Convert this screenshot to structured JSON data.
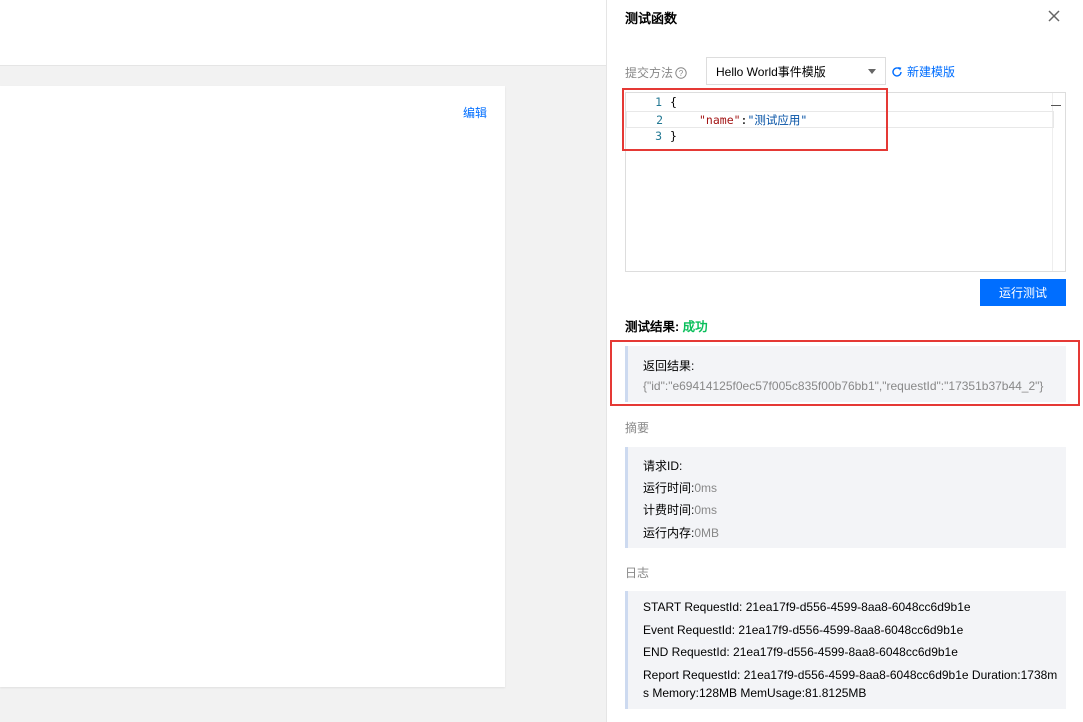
{
  "background": {
    "edit_label": "编辑"
  },
  "panel": {
    "title": "测试函数",
    "submit_method_label": "提交方法",
    "template_select_value": "Hello World事件模版",
    "new_template_label": "新建模版",
    "editor_lines": [
      {
        "no": "1",
        "code": "{"
      },
      {
        "no": "2",
        "key": "\"name\"",
        "sep": ":",
        "val": "\"测试应用\""
      },
      {
        "no": "3",
        "code": "}"
      }
    ],
    "run_button_label": "运行测试",
    "result_title": "测试结果:",
    "result_status": "成功",
    "return_label": "返回结果:",
    "return_value": "{\"id\":\"e69414125f0ec57f005c835f00b76bb1\",\"requestId\":\"17351b37b44_2\"}",
    "summary_label": "摘要",
    "summary": {
      "request_id_label": "请求ID:",
      "request_id_value": "",
      "run_time_label": "运行时间:",
      "run_time_value": "0ms",
      "billing_time_label": "计费时间:",
      "billing_time_value": "0ms",
      "memory_label": "运行内存:",
      "memory_value": "0MB"
    },
    "log_label": "日志",
    "log_lines": [
      "START RequestId: 21ea17f9-d556-4599-8aa8-6048cc6d9b1e",
      "Event RequestId: 21ea17f9-d556-4599-8aa8-6048cc6d9b1e",
      "END RequestId: 21ea17f9-d556-4599-8aa8-6048cc6d9b1e",
      "Report RequestId: 21ea17f9-d556-4599-8aa8-6048cc6d9b1e Duration:1738m",
      "s Memory:128MB MemUsage:81.8125MB"
    ]
  },
  "colors": {
    "accent": "#006eff",
    "success": "#0abf5b",
    "highlight_border": "#e53935"
  },
  "icons": [
    "close-icon",
    "help-icon",
    "refresh-icon",
    "chevron-down-icon"
  ]
}
